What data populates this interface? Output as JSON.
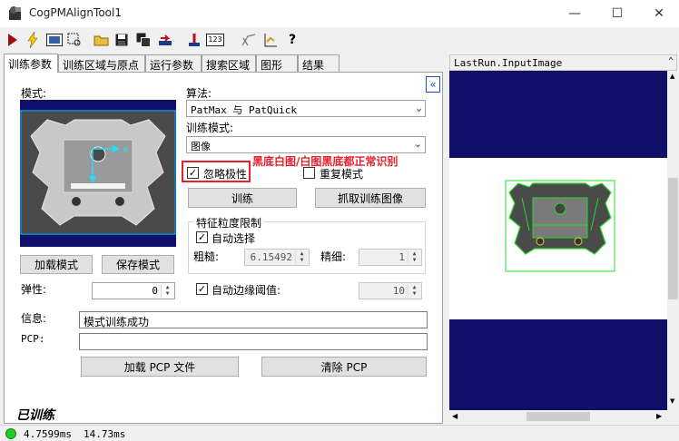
{
  "window": {
    "title": "CogPMAlignTool1",
    "minimize_glyph": "—",
    "maximize_glyph": "☐",
    "close_glyph": "✕"
  },
  "toolbar": {
    "icons": [
      "run-icon",
      "electric-run-icon",
      "show-image-icon",
      "show-regions-icon",
      "open-icon",
      "save-icon",
      "save-as-icon",
      "reset-icon",
      "input-icon",
      "value-123-icon",
      "graphics-icon",
      "stats-icon",
      "help-icon"
    ]
  },
  "tabs": [
    {
      "label": "训练参数",
      "active": true
    },
    {
      "label": "训练区域与原点",
      "active": false
    },
    {
      "label": "运行参数",
      "active": false
    },
    {
      "label": "搜索区域",
      "active": false
    },
    {
      "label": "图形",
      "active": false
    },
    {
      "label": "结果",
      "active": false
    }
  ],
  "train_params": {
    "model_label": "模式:",
    "collapse_glyph": "«",
    "algorithm_label": "算法:",
    "algorithm_value": "PatMax 与 PatQuick",
    "train_mode_label": "训练模式:",
    "train_mode_value": "图像",
    "ignore_polarity_label": "忽略极性",
    "ignore_polarity_checked": true,
    "annotation": "黑底白图/白图黑底都正常识别",
    "repeat_mode_label": "重复模式",
    "repeat_mode_checked": false,
    "train_button": "训练",
    "grab_train_image_button": "抓取训练图像",
    "feature_group_title": "特征粒度限制",
    "auto_select_label": "自动选择",
    "auto_select_checked": true,
    "coarse_label": "粗糙:",
    "coarse_value": "6.15492",
    "fine_label": "精细:",
    "fine_value": "1",
    "load_model_button": "加载模式",
    "save_model_button": "保存模式",
    "elasticity_label": "弹性:",
    "elasticity_value": "0",
    "auto_edge_label": "自动边缘阈值:",
    "auto_edge_checked": true,
    "auto_edge_value": "10",
    "info_label": "信息:",
    "info_value": "模式训练成功",
    "pcp_label": "PCP:",
    "pcp_value": "",
    "load_pcp_button": "加载 PCP 文件",
    "clear_pcp_button": "清除 PCP",
    "trained_status": "已训练"
  },
  "image_view": {
    "header": "LastRun.InputImage"
  },
  "status_bar": {
    "time1": "4.7599ms",
    "time2": "14.73ms",
    "status_color": "#22cc22"
  },
  "colors": {
    "navy": "#10106a",
    "annotation_red": "#e8202a",
    "match_green": "#22dd22",
    "model_cyan": "#20e0ff"
  }
}
